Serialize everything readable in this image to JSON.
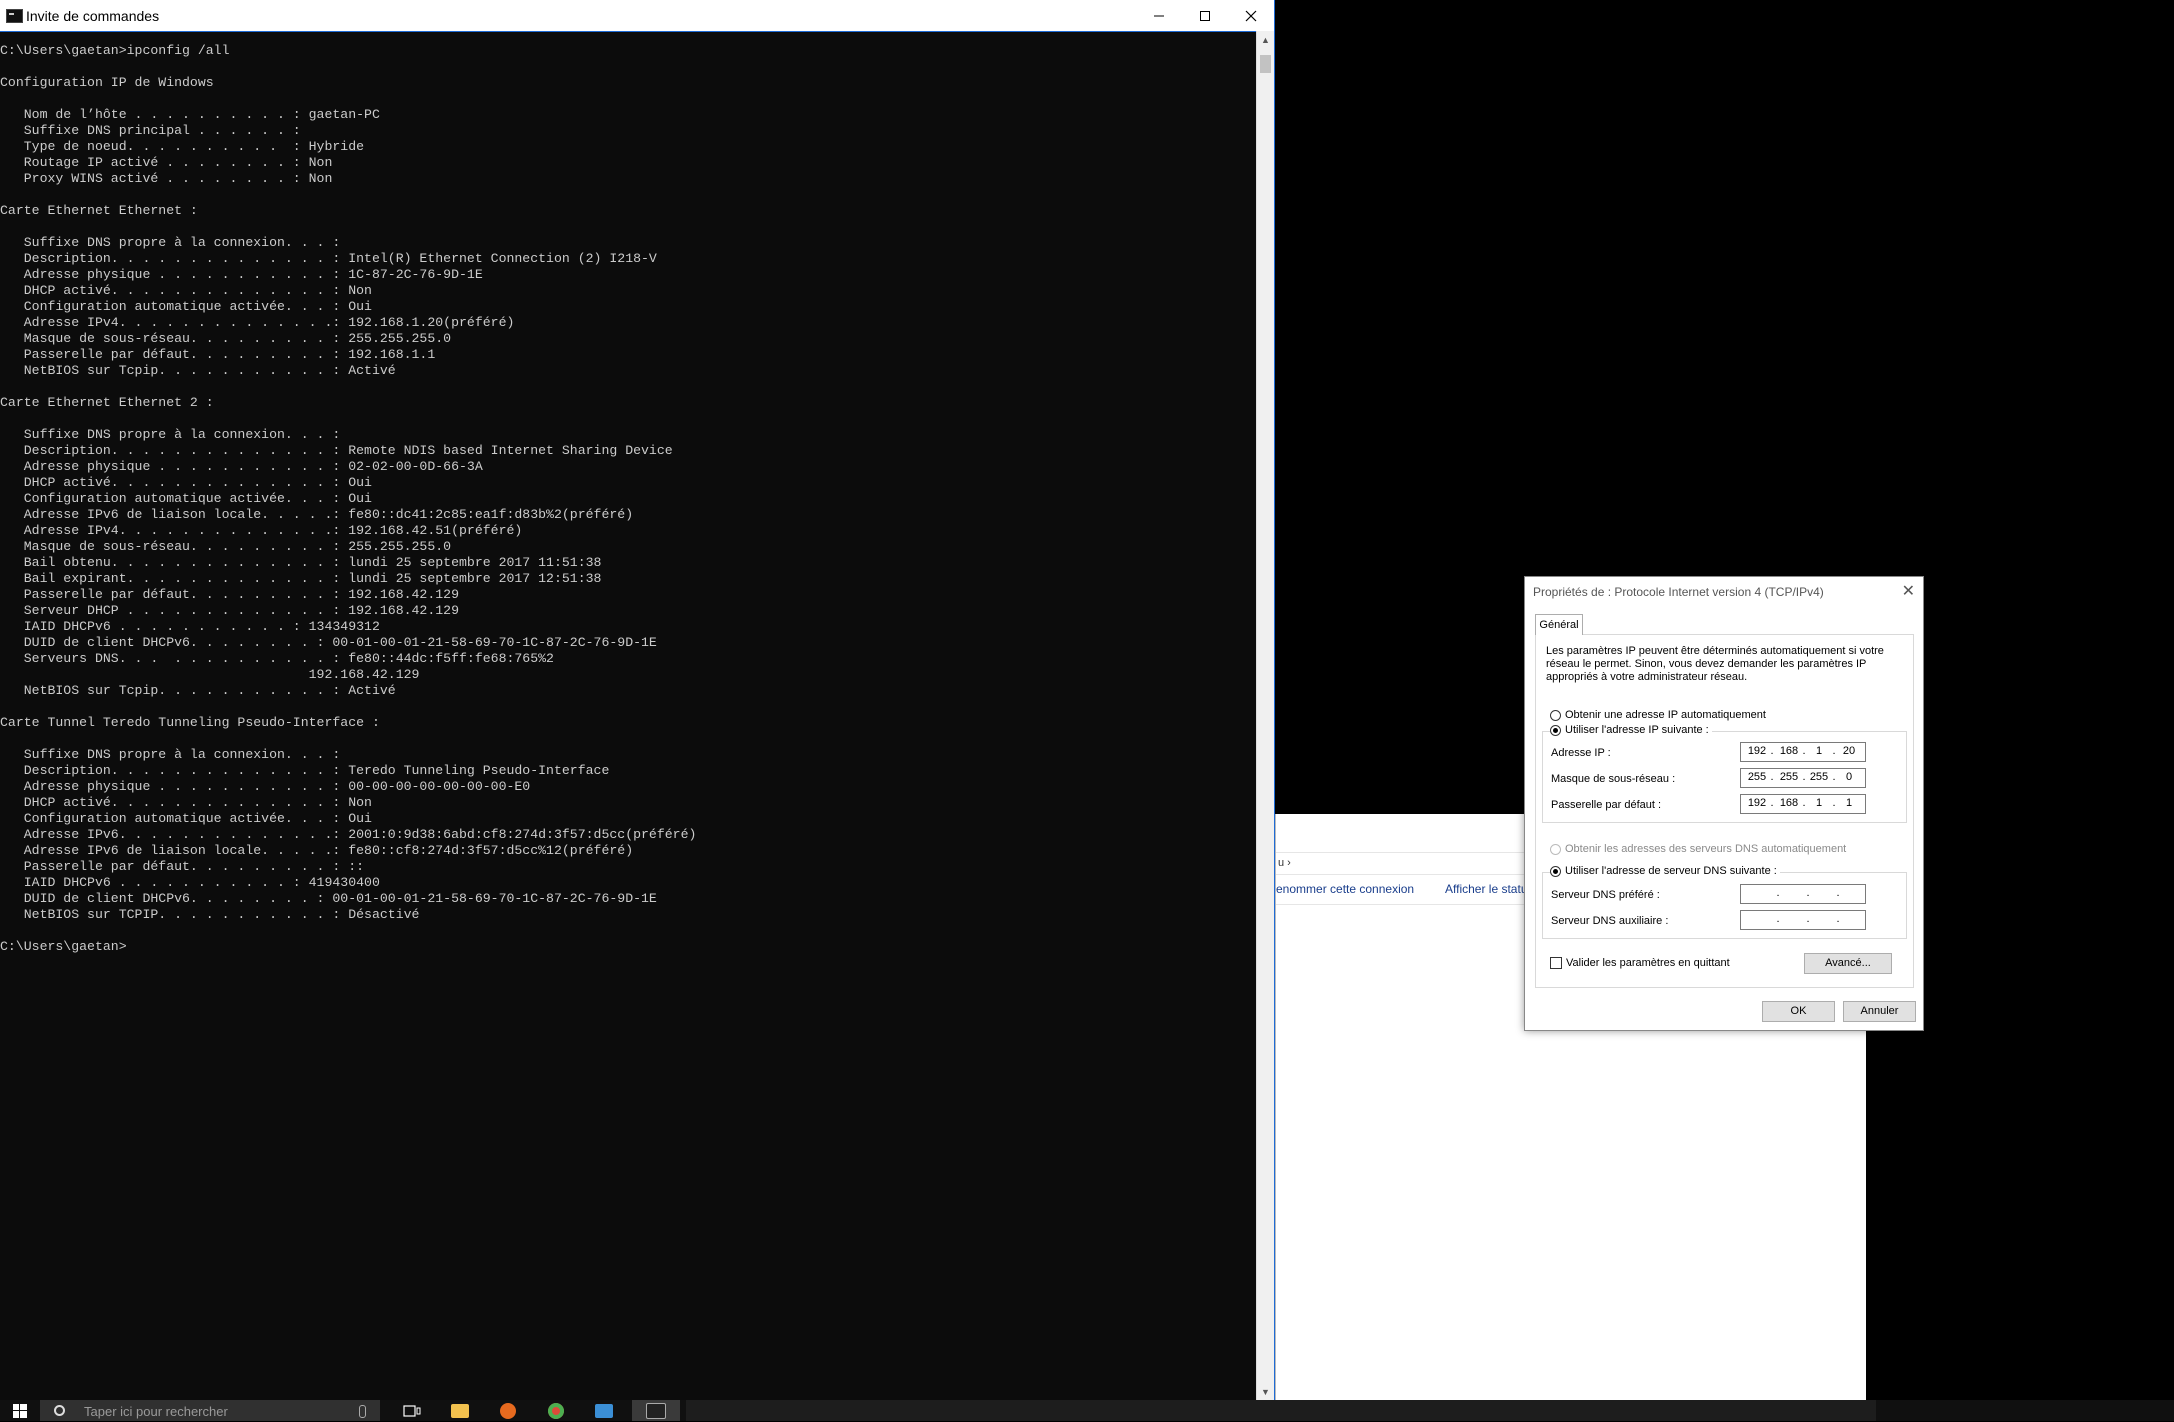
{
  "console": {
    "title": "Invite de commandes",
    "lines": [
      "C:\\Users\\gaetan>ipconfig /all",
      "",
      "Configuration IP de Windows",
      "",
      "   Nom de l’hôte . . . . . . . . . . : gaetan-PC",
      "   Suffixe DNS principal . . . . . . :",
      "   Type de noeud. . . . . . . . . .  : Hybride",
      "   Routage IP activé . . . . . . . . : Non",
      "   Proxy WINS activé . . . . . . . . : Non",
      "",
      "Carte Ethernet Ethernet :",
      "",
      "   Suffixe DNS propre à la connexion. . . :",
      "   Description. . . . . . . . . . . . . . : Intel(R) Ethernet Connection (2) I218-V",
      "   Adresse physique . . . . . . . . . . . : 1C-87-2C-76-9D-1E",
      "   DHCP activé. . . . . . . . . . . . . . : Non",
      "   Configuration automatique activée. . . : Oui",
      "   Adresse IPv4. . . . . . . . . . . . . .: 192.168.1.20(préféré)",
      "   Masque de sous-réseau. . . . . . . . . : 255.255.255.0",
      "   Passerelle par défaut. . . . . . . . . : 192.168.1.1",
      "   NetBIOS sur Tcpip. . . . . . . . . . . : Activé",
      "",
      "Carte Ethernet Ethernet 2 :",
      "",
      "   Suffixe DNS propre à la connexion. . . :",
      "   Description. . . . . . . . . . . . . . : Remote NDIS based Internet Sharing Device",
      "   Adresse physique . . . . . . . . . . . : 02-02-00-0D-66-3A",
      "   DHCP activé. . . . . . . . . . . . . . : Oui",
      "   Configuration automatique activée. . . : Oui",
      "   Adresse IPv6 de liaison locale. . . . .: fe80::dc41:2c85:ea1f:d83b%2(préféré)",
      "   Adresse IPv4. . . . . . . . . . . . . .: 192.168.42.51(préféré)",
      "   Masque de sous-réseau. . . . . . . . . : 255.255.255.0",
      "   Bail obtenu. . . . . . . . . . . . . . : lundi 25 septembre 2017 11:51:38",
      "   Bail expirant. . . . . . . . . . . . . : lundi 25 septembre 2017 12:51:38",
      "   Passerelle par défaut. . . . . . . . . : 192.168.42.129",
      "   Serveur DHCP . . . . . . . . . . . . . : 192.168.42.129",
      "   IAID DHCPv6 . . . . . . . . . . . : 134349312",
      "   DUID de client DHCPv6. . . . . . . . : 00-01-00-01-21-58-69-70-1C-87-2C-76-9D-1E",
      "   Serveurs DNS. . .  . . . . . . . . . . : fe80::44dc:f5ff:fe68:765%2",
      "                                       192.168.42.129",
      "   NetBIOS sur Tcpip. . . . . . . . . . . : Activé",
      "",
      "Carte Tunnel Teredo Tunneling Pseudo-Interface :",
      "",
      "   Suffixe DNS propre à la connexion. . . :",
      "   Description. . . . . . . . . . . . . . : Teredo Tunneling Pseudo-Interface",
      "   Adresse physique . . . . . . . . . . . : 00-00-00-00-00-00-00-E0",
      "   DHCP activé. . . . . . . . . . . . . . : Non",
      "   Configuration automatique activée. . . : Oui",
      "   Adresse IPv6. . . . . . . . . . . . . .: 2001:0:9d38:6abd:cf8:274d:3f57:d5cc(préféré)",
      "   Adresse IPv6 de liaison locale. . . . .: fe80::cf8:274d:3f57:d5cc%12(préféré)",
      "   Passerelle par défaut. . . . . . . . . : ::",
      "   IAID DHCPv6 . . . . . . . . . . . : 419430400",
      "   DUID de client DHCPv6. . . . . . . . : 00-01-00-01-21-58-69-70-1C-87-2C-76-9D-1E",
      "   NetBIOS sur TCPIP. . . . . . . . . . . : Désactivé",
      "",
      "C:\\Users\\gaetan>"
    ]
  },
  "explorer": {
    "breadcrumb": "u  ›",
    "commands": [
      "enommer cette connexion",
      "Afficher le statut"
    ]
  },
  "dialog": {
    "title": "Propriétés de : Protocole Internet version 4 (TCP/IPv4)",
    "tab": "Général",
    "intro": "Les paramètres IP peuvent être déterminés automatiquement si votre réseau le permet. Sinon, vous devez demander les paramètres IP appropriés à votre administrateur réseau.",
    "radio_auto_ip": "Obtenir une adresse IP automatiquement",
    "radio_manual_ip": "Utiliser l'adresse IP suivante :",
    "ip_label": "Adresse IP :",
    "mask_label": "Masque de sous-réseau :",
    "gateway_label": "Passerelle par défaut :",
    "ip": [
      "192",
      "168",
      "1",
      "20"
    ],
    "mask": [
      "255",
      "255",
      "255",
      "0"
    ],
    "gateway": [
      "192",
      "168",
      "1",
      "1"
    ],
    "radio_auto_dns": "Obtenir les adresses des serveurs DNS automatiquement",
    "radio_manual_dns": "Utiliser l'adresse de serveur DNS suivante :",
    "dns_pref_label": "Serveur DNS préféré :",
    "dns_alt_label": "Serveur DNS auxiliaire :",
    "validate_label": "Valider les paramètres en quittant",
    "advanced_button": "Avancé...",
    "ok_button": "OK",
    "cancel_button": "Annuler"
  },
  "taskbar": {
    "search_placeholder": "Taper ici pour rechercher"
  }
}
